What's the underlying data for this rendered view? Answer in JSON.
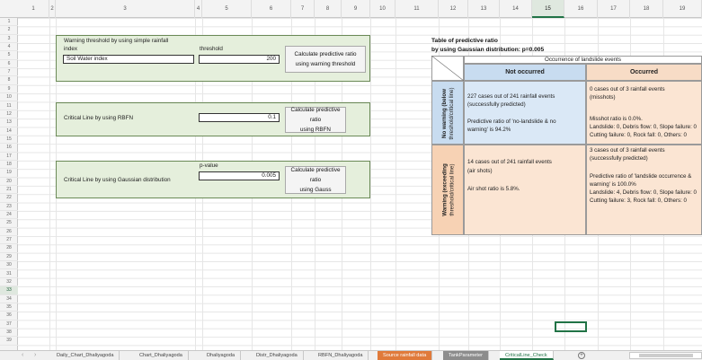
{
  "columns": [
    "1",
    "2",
    "3",
    "4",
    "5",
    "6",
    "7",
    "8",
    "9",
    "10",
    "11",
    "12",
    "13",
    "14",
    "15",
    "16",
    "17",
    "18",
    "19"
  ],
  "rows": [
    "1",
    "2",
    "3",
    "4",
    "5",
    "6",
    "7",
    "8",
    "9",
    "10",
    "11",
    "12",
    "13",
    "14",
    "15",
    "16",
    "17",
    "18",
    "19",
    "20",
    "21",
    "22",
    "23",
    "24",
    "25",
    "26",
    "27",
    "28",
    "29",
    "30",
    "31",
    "32",
    "33",
    "34",
    "35",
    "36",
    "37",
    "38",
    "39"
  ],
  "active_column": "15",
  "active_row": "33",
  "panel1": {
    "label_line1": "Warning threshold by using simple rainfall",
    "label_line2": "index",
    "index_value": "Soil Water index",
    "threshold_label": "threshold",
    "threshold_value": "200",
    "button_line1": "Calculate predictive ratio",
    "button_line2": "using warning threshold"
  },
  "panel2": {
    "label": "Critical Line by using RBFN",
    "value": "0.1",
    "button_line1": "Calculate predictive ratio",
    "button_line2": "using RBFN"
  },
  "panel3": {
    "label": "Critical Line by using Gaussian distribution",
    "pvalue_label": "p-value",
    "value": "0.005",
    "button_line1": "Calculate predictive ratio",
    "button_line2": "using Gauss"
  },
  "result_table": {
    "title_line1": "Table of predictive ratio",
    "title_line2": "by using Gaussian distribution: p=0.005",
    "occurrence_header": "Occurrence of landslide events",
    "col_not_occurred": "Not occurred",
    "col_occurred": "Occurred",
    "row_no_warning_line1": "No warning (below",
    "row_no_warning_line2": "threshold/critical line)",
    "row_warning_line1": "Warning (exceeding",
    "row_warning_line2": "threshold/critical line)",
    "cell_nw_no": {
      "l1": "227 cases out of 241 rainfall events",
      "l2": "(successfully predicted)",
      "l3": "",
      "l4": "Predictive ratio of 'no-landslide & no",
      "l5": "warning' is 94.2%"
    },
    "cell_nw_occ": {
      "l1": "0 cases out of 3 rainfall events",
      "l2": "(misshots)",
      "l3": "",
      "l4": "Misshot ratio is 0.0%.",
      "l5": "Landslide: 0, Debris flow: 0, Slope failure: 0",
      "l6": "Cutting failure: 0, Rock fall: 0, Others: 0"
    },
    "cell_w_no": {
      "l1": "14 cases out of 241 rainfall events",
      "l2": "(air shots)",
      "l3": "",
      "l4": "Air shot ratio is 5.8%."
    },
    "cell_w_occ": {
      "l1": "3 cases out of 3 rainfall events",
      "l2": "(successfully predicted)",
      "l3": "",
      "l4": "Predictive ratio of 'landslide occurrence &",
      "l5": "warning' is 100.0%",
      "l6": "Landslide: 4, Debris flow: 0, Slope failure: 0",
      "l7": "Cutting failure: 3, Rock fall: 0, Others: 0"
    }
  },
  "tabs": [
    {
      "label": "Daily_Chart_Dhaliyagoda",
      "style": "normal"
    },
    {
      "label": "Chart_Dhaliyagoda",
      "style": "normal"
    },
    {
      "label": "Dhaliyagoda",
      "style": "normal"
    },
    {
      "label": "Distr_Dhaliyagoda",
      "style": "normal"
    },
    {
      "label": "RBFN_Dhaliyagoda",
      "style": "normal"
    },
    {
      "label": "Source rainfall data",
      "style": "orange"
    },
    {
      "label": "TankParameter",
      "style": "gray"
    },
    {
      "label": "CriticalLine_Check",
      "style": "active"
    }
  ],
  "add_sheet_symbol": "+",
  "nav_prev": "‹",
  "nav_next": "›",
  "colors": {
    "panel_green": "#e5efdc",
    "header_blue": "#c8dcf0",
    "header_peach": "#f7dcc6",
    "tab_orange": "#e07a3a",
    "tab_gray": "#8c8c8c",
    "excel_green": "#217346"
  }
}
